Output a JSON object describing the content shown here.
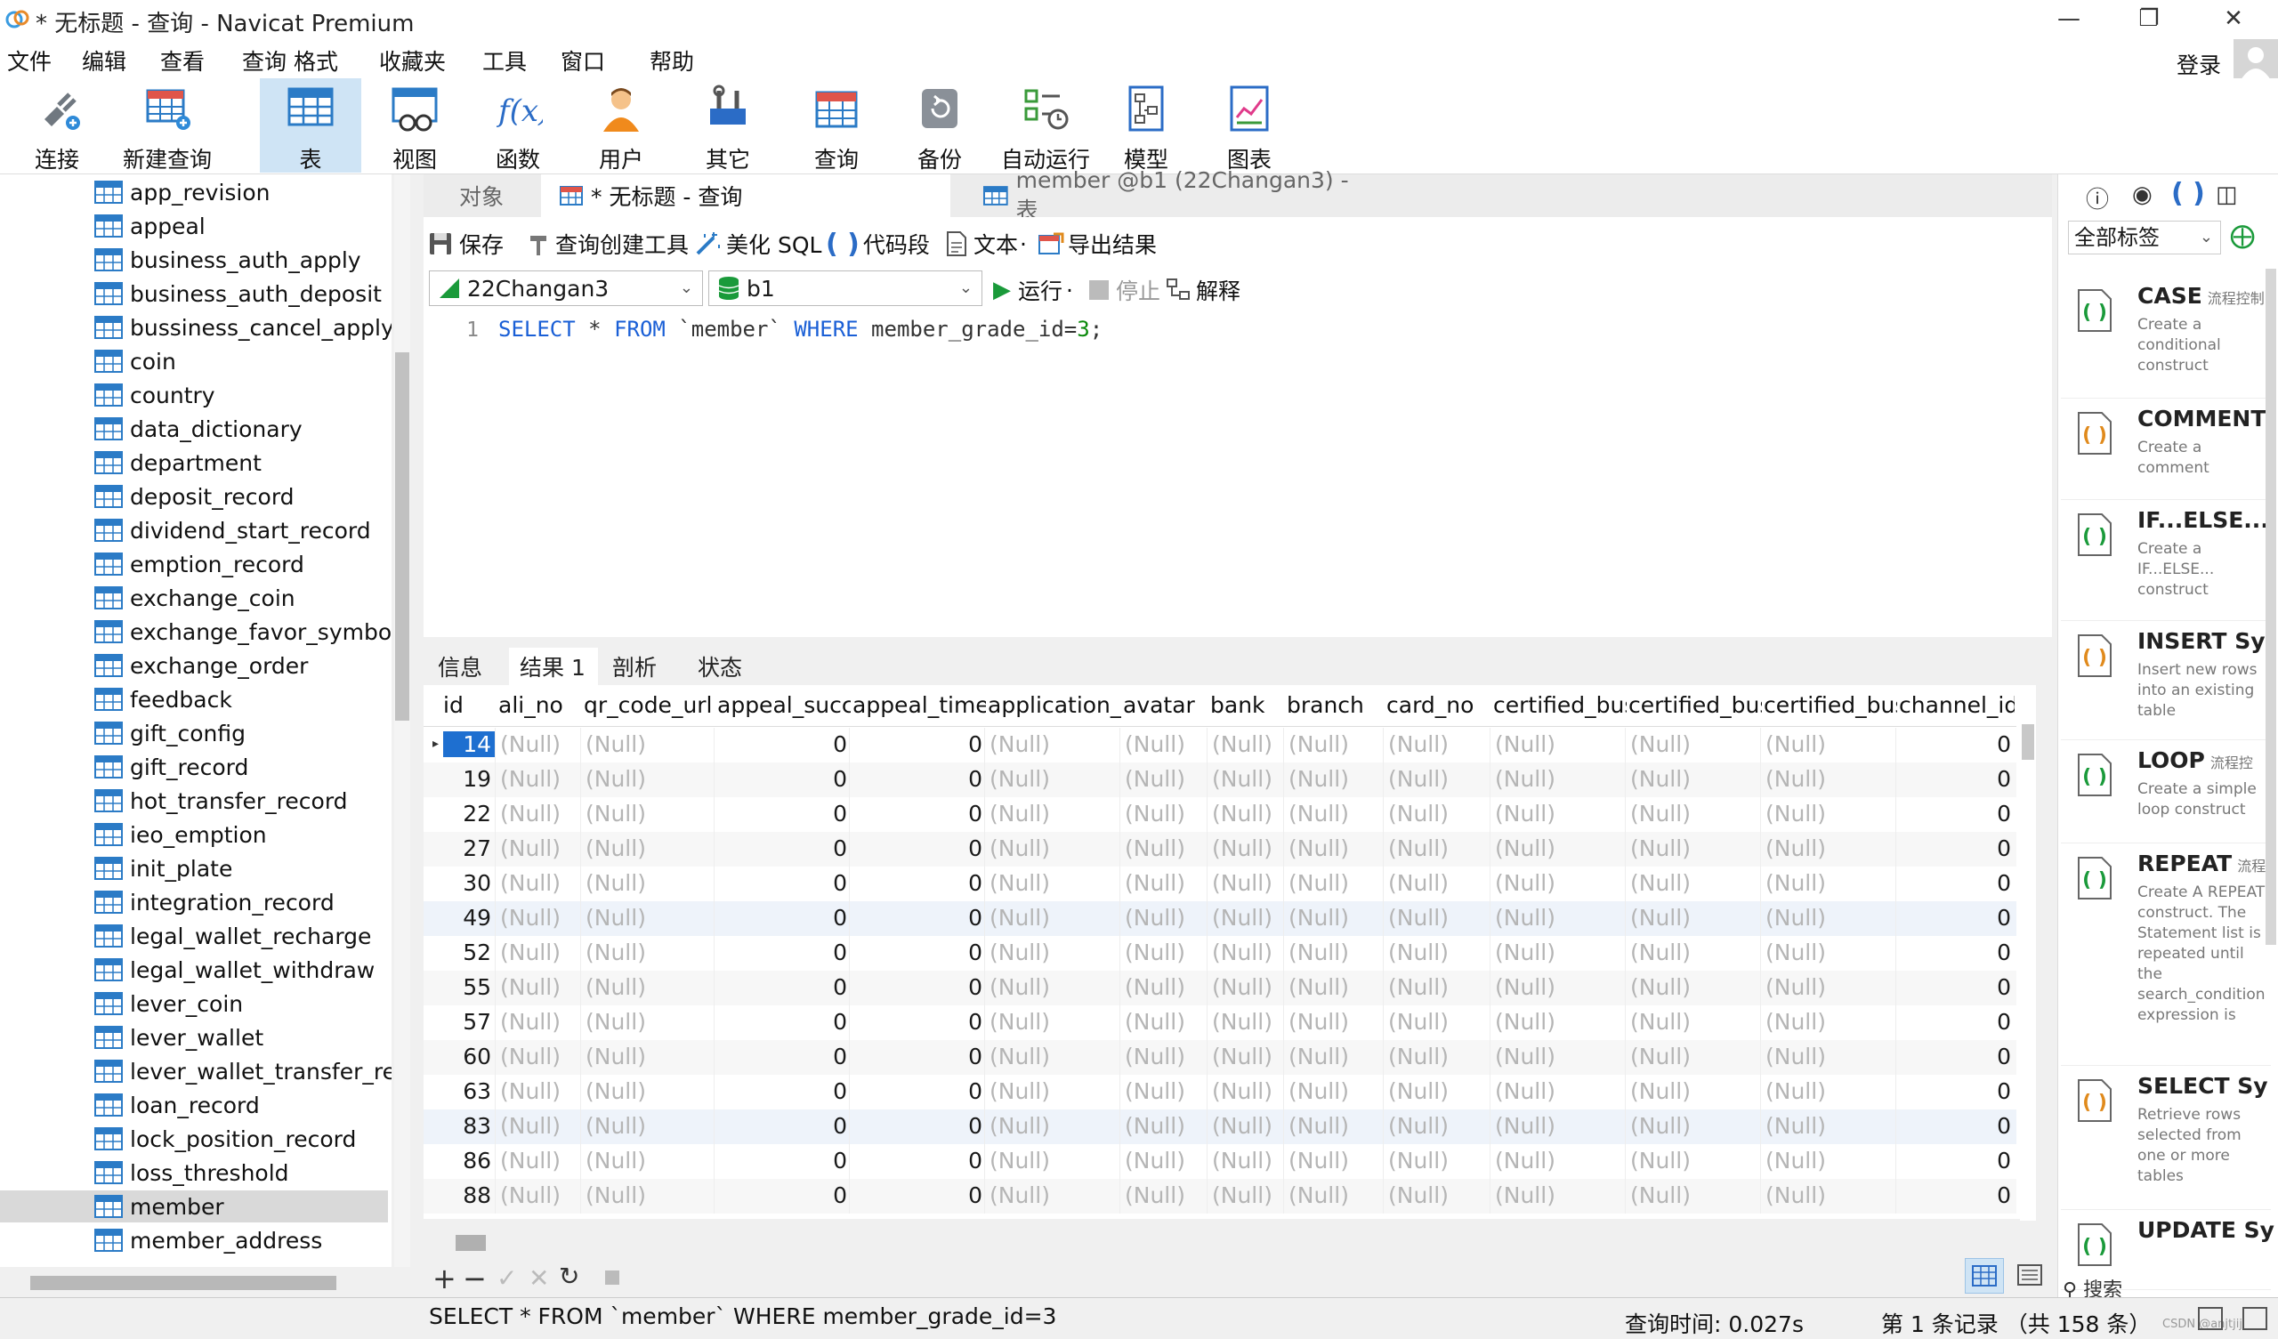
{
  "window": {
    "title": "* 无标题 - 查询 - Navicat Premium"
  },
  "menu": [
    "文件",
    "编辑",
    "查看",
    "查询",
    "格式",
    "收藏夹",
    "工具",
    "窗口",
    "帮助"
  ],
  "login": "登录",
  "toolbar": [
    {
      "label": "连接",
      "icon": "plug-icon"
    },
    {
      "label": "新建查询",
      "icon": "new-query-icon"
    },
    {
      "label": "表",
      "icon": "table-icon"
    },
    {
      "label": "视图",
      "icon": "view-icon"
    },
    {
      "label": "函数",
      "icon": "function-icon"
    },
    {
      "label": "用户",
      "icon": "user-icon"
    },
    {
      "label": "其它",
      "icon": "tools-icon"
    },
    {
      "label": "查询",
      "icon": "query-icon"
    },
    {
      "label": "备份",
      "icon": "backup-icon"
    },
    {
      "label": "自动运行",
      "icon": "schedule-icon"
    },
    {
      "label": "模型",
      "icon": "model-icon"
    },
    {
      "label": "图表",
      "icon": "chart-icon"
    }
  ],
  "sidebar": {
    "tables": [
      "app_revision",
      "appeal",
      "business_auth_apply",
      "business_auth_deposit",
      "bussiness_cancel_apply",
      "coin",
      "country",
      "data_dictionary",
      "department",
      "deposit_record",
      "dividend_start_record",
      "emption_record",
      "exchange_coin",
      "exchange_favor_symbol",
      "exchange_order",
      "feedback",
      "gift_config",
      "gift_record",
      "hot_transfer_record",
      "ieo_emption",
      "init_plate",
      "integration_record",
      "legal_wallet_recharge",
      "legal_wallet_withdraw",
      "lever_coin",
      "lever_wallet",
      "lever_wallet_transfer_recc",
      "loan_record",
      "lock_position_record",
      "loss_threshold",
      "member",
      "member_address"
    ],
    "selected": "member"
  },
  "tabs": {
    "objects": "对象",
    "query": "* 无标题 - 查询",
    "member_table": "member @b1 (22Changan3) - 表"
  },
  "query_toolbar": {
    "save": "保存",
    "builder": "查询创建工具",
    "beautify": "美化 SQL",
    "snippet": "代码段",
    "text": "文本",
    "export": "导出结果"
  },
  "connection": {
    "server": "22Changan3",
    "database": "b1",
    "run": "运行",
    "stop": "停止",
    "explain": "解释"
  },
  "editor": {
    "line": "1",
    "sql_kw1": "SELECT",
    "sql_star": " * ",
    "sql_kw2": "FROM",
    "sql_tbl": " `member` ",
    "sql_kw3": "WHERE",
    "sql_cond": " member_grade_id=",
    "sql_val": "3",
    "sql_end": ";"
  },
  "result_tabs": [
    "信息",
    "结果 1",
    "剖析",
    "状态"
  ],
  "grid": {
    "columns": [
      "id",
      "ali_no",
      "qr_code_url",
      "appeal_succe",
      "appeal_times",
      "application_t",
      "avatar",
      "bank",
      "branch",
      "card_no",
      "certified_bus",
      "certified_bus",
      "certified_bus",
      "channel_id"
    ],
    "ids": [
      "14",
      "19",
      "22",
      "27",
      "30",
      "49",
      "52",
      "55",
      "57",
      "60",
      "63",
      "83",
      "86",
      "88"
    ],
    "null_text": "(Null)",
    "zero": "0"
  },
  "right_panel": {
    "filter": "全部标签",
    "snippets": [
      {
        "title": "CASE",
        "tag": "流程控制",
        "desc": "Create a conditional construct"
      },
      {
        "title": "COMMENT",
        "tag": "",
        "desc": "Create a comment"
      },
      {
        "title": "IF...ELSE...",
        "tag": "",
        "desc": "Create a IF...ELSE... construct"
      },
      {
        "title": "INSERT Sy",
        "tag": "",
        "desc": "Insert new rows into an existing table"
      },
      {
        "title": "LOOP",
        "tag": "流程控",
        "desc": "Create a simple loop construct"
      },
      {
        "title": "REPEAT",
        "tag": "流程",
        "desc": "Create A REPEAT construct. The Statement list is repeated until the search_condition expression is"
      },
      {
        "title": "SELECT Sy",
        "tag": "",
        "desc": "Retrieve rows selected from one or more tables"
      },
      {
        "title": "UPDATE Sy",
        "tag": "",
        "desc": ""
      }
    ],
    "search": "搜索"
  },
  "status": {
    "sql": "SELECT * FROM `member` WHERE member_grade_id=3",
    "time": "查询时间: 0.027s",
    "records": "第 1 条记录 （共 158 条）",
    "watermark": "CSDN @anjtjij"
  }
}
